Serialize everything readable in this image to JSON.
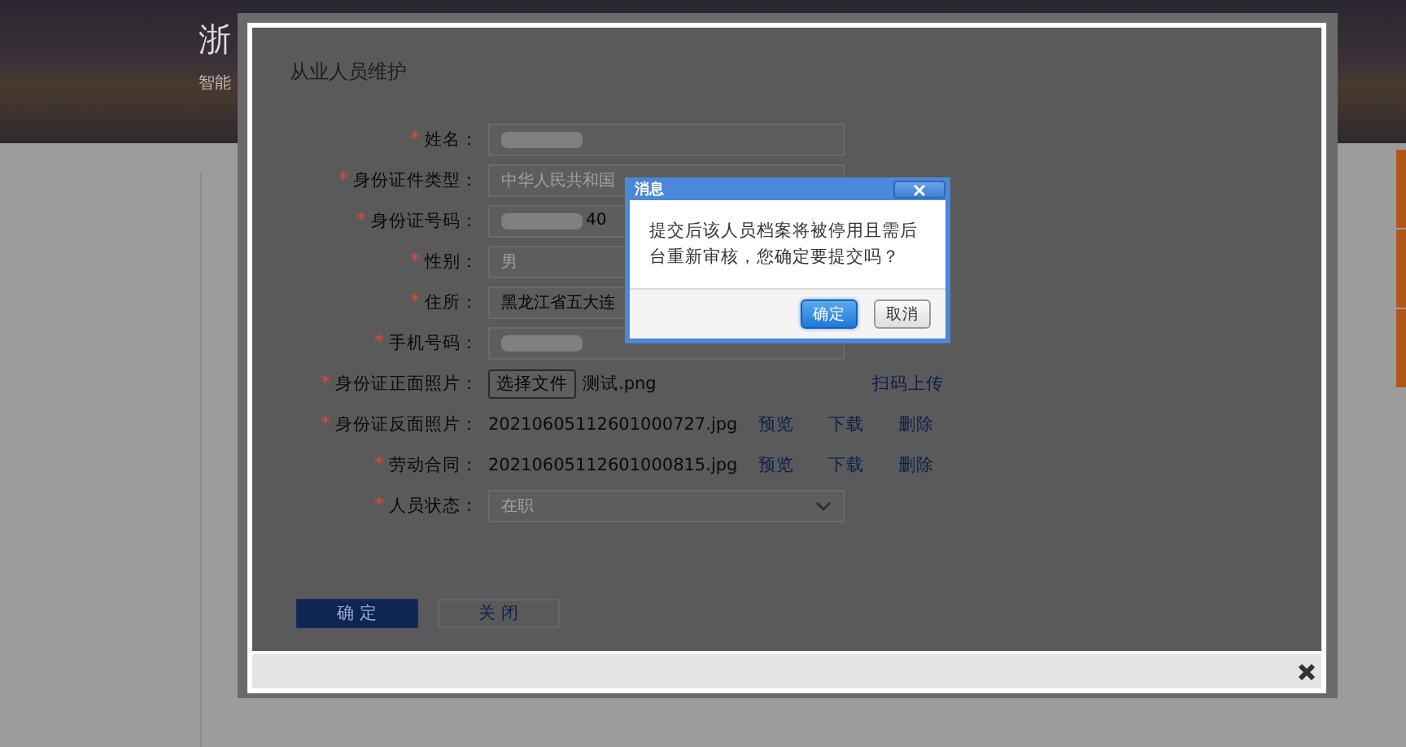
{
  "page": {
    "header_title": "浙",
    "header_subtitle": "智能"
  },
  "modal": {
    "title": "从业人员维护",
    "fields": [
      {
        "mark": "*",
        "label": "姓名：",
        "kind": "redacted"
      },
      {
        "mark": "*",
        "label": "身份证件类型：",
        "kind": "text",
        "value": "中华人民共和国",
        "disabled": true
      },
      {
        "mark": "*",
        "label": "身份证号码：",
        "kind": "redacted",
        "value": "40"
      },
      {
        "mark": "*",
        "label": "性别：",
        "kind": "text",
        "value": "男",
        "disabled": true
      },
      {
        "mark": "*",
        "label": "住所：",
        "kind": "text",
        "value": "黑龙江省五大连",
        "disabled": false
      },
      {
        "mark": "*",
        "label": "手机号码：",
        "kind": "redacted"
      },
      {
        "mark": "*",
        "label": "身份证正面照片：",
        "kind": "upload",
        "button": "选择文件",
        "file": "测试.png",
        "link": "扫码上传"
      },
      {
        "mark": "*",
        "label": "身份证反面照片：",
        "kind": "file",
        "file": "20210605112601000727.jpg",
        "actions": [
          "预览",
          "下载",
          "删除"
        ]
      },
      {
        "mark": "*",
        "label": "劳动合同：",
        "kind": "file",
        "file": "20210605112601000815.jpg",
        "actions": [
          "预览",
          "下载",
          "删除"
        ]
      },
      {
        "mark": "*",
        "label": "人员状态：",
        "kind": "select",
        "value": "在职",
        "disabled": true
      }
    ],
    "buttons": [
      {
        "label": "确 定",
        "kind": "primary"
      },
      {
        "label": "关 闭",
        "kind": "secondary"
      }
    ]
  },
  "dialog": {
    "title": "消息",
    "message": "提交后该人员档案将被停用且需后台重新审核，您确定要提交吗？",
    "buttons": [
      {
        "label": "确定",
        "kind": "primary"
      },
      {
        "label": "取消",
        "kind": "secondary"
      }
    ]
  }
}
